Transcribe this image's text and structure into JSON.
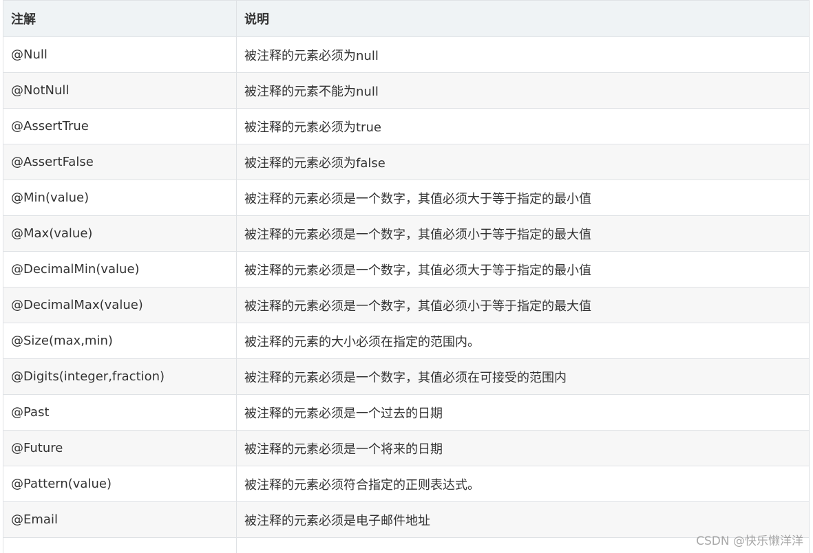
{
  "table": {
    "headers": [
      "注解",
      "说明"
    ],
    "rows": [
      [
        "@Null",
        "被注释的元素必须为null"
      ],
      [
        "@NotNull",
        "被注释的元素不能为null"
      ],
      [
        "@AssertTrue",
        "被注释的元素必须为true"
      ],
      [
        "@AssertFalse",
        "被注释的元素必须为false"
      ],
      [
        "@Min(value)",
        "被注释的元素必须是一个数字，其值必须大于等于指定的最小值"
      ],
      [
        "@Max(value)",
        "被注释的元素必须是一个数字，其值必须小于等于指定的最大值"
      ],
      [
        "@DecimalMin(value)",
        "被注释的元素必须是一个数字，其值必须大于等于指定的最小值"
      ],
      [
        "@DecimalMax(value)",
        "被注释的元素必须是一个数字，其值必须小于等于指定的最大值"
      ],
      [
        "@Size(max,min)",
        "被注释的元素的大小必须在指定的范围内。"
      ],
      [
        "@Digits(integer,fraction)",
        "被注释的元素必须是一个数字，其值必须在可接受的范围内"
      ],
      [
        "@Past",
        "被注释的元素必须是一个过去的日期"
      ],
      [
        "@Future",
        "被注释的元素必须是一个将来的日期"
      ],
      [
        "@Pattern(value)",
        "被注释的元素必须符合指定的正则表达式。"
      ],
      [
        "@Email",
        "被注释的元素必须是电子邮件地址"
      ],
      [
        "",
        ""
      ]
    ]
  },
  "watermark": "CSDN @快乐懒洋洋"
}
